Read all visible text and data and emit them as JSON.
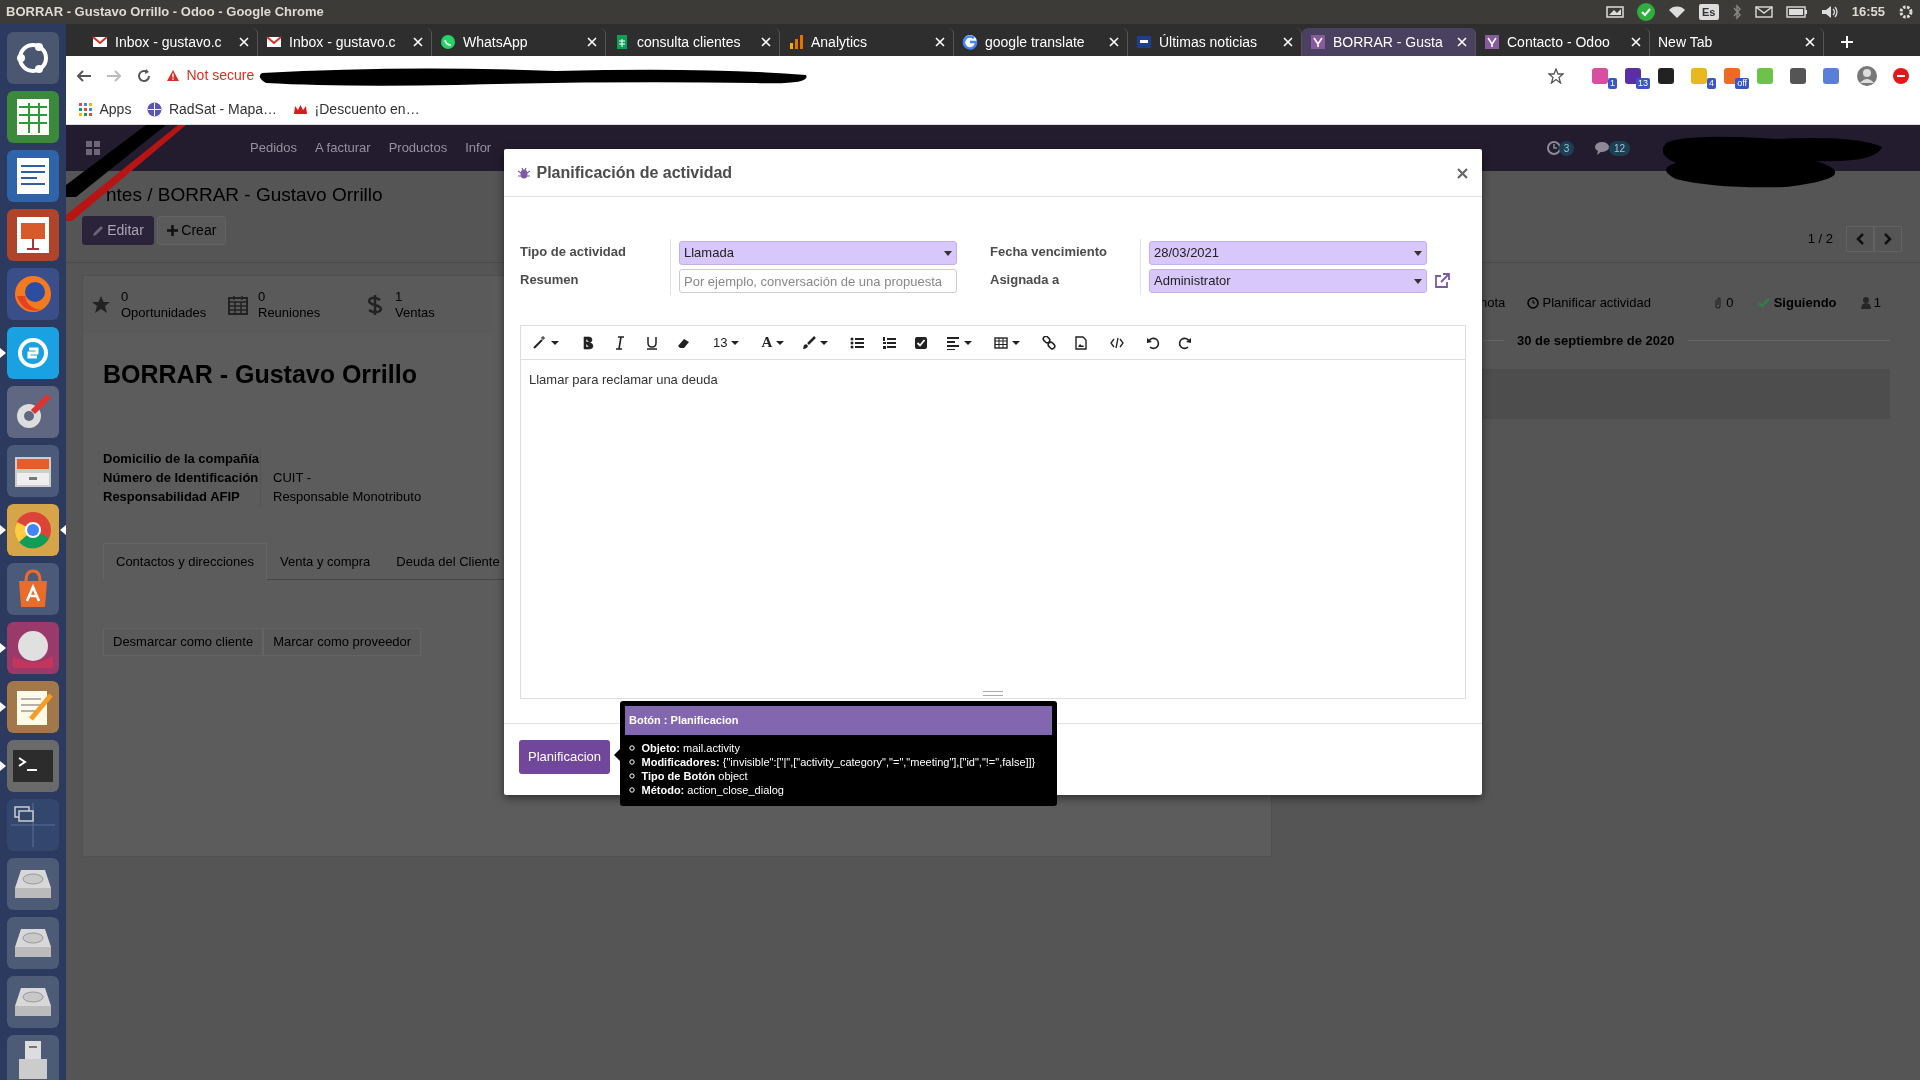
{
  "top_bar": {
    "title": "BORRAR - Gustavo Orrillo - Odoo - Google Chrome",
    "keyboard_layout": "Es",
    "time": "16:55"
  },
  "launcher": [
    {
      "kind": "ubuntu",
      "running": false,
      "focused": false
    },
    {
      "kind": "calc",
      "running": false,
      "focused": false
    },
    {
      "kind": "writer",
      "running": false,
      "focused": false
    },
    {
      "kind": "impress",
      "running": false,
      "focused": false
    },
    {
      "kind": "firefox",
      "running": false,
      "focused": false
    },
    {
      "kind": "skype",
      "running": true,
      "focused": false
    },
    {
      "kind": "settings",
      "running": false,
      "focused": false
    },
    {
      "kind": "cabinet",
      "running": false,
      "focused": false
    },
    {
      "kind": "chrome",
      "running": true,
      "focused": true
    },
    {
      "kind": "store",
      "running": false,
      "focused": false
    },
    {
      "kind": "ball",
      "running": true,
      "focused": false
    },
    {
      "kind": "editor",
      "running": true,
      "focused": false
    },
    {
      "kind": "terminal",
      "running": true,
      "focused": false
    },
    {
      "kind": "workspaces",
      "running": false,
      "focused": false
    },
    {
      "kind": "drive",
      "running": false,
      "focused": false
    },
    {
      "kind": "drive",
      "running": false,
      "focused": false
    },
    {
      "kind": "drive",
      "running": false,
      "focused": false
    },
    {
      "kind": "usb",
      "running": false,
      "focused": false
    }
  ],
  "tabs": [
    {
      "title": "Inbox - gustavo.c",
      "kind": "mail",
      "selected": false
    },
    {
      "title": "Inbox - gustavo.c",
      "kind": "mail",
      "selected": false
    },
    {
      "title": "WhatsApp",
      "kind": "chat",
      "selected": false
    },
    {
      "title": "consulta clientes",
      "kind": "sheet",
      "selected": false
    },
    {
      "title": "Analytics",
      "kind": "analytics",
      "selected": false
    },
    {
      "title": "google translate",
      "kind": "google",
      "selected": false
    },
    {
      "title": "Últimas noticias",
      "kind": "news",
      "selected": false
    },
    {
      "title": "BORRAR - Gusta",
      "kind": "odoo",
      "selected": true
    },
    {
      "title": "Contacto - Odoo",
      "kind": "odoo",
      "selected": false
    },
    {
      "title": "New Tab",
      "kind": "blank",
      "selected": false
    }
  ],
  "address_bar": {
    "security": "Not secure"
  },
  "extensions": [
    {
      "color": "#d94fa0",
      "badge": "1"
    },
    {
      "color": "#5a2ea6",
      "badge": "13"
    },
    {
      "color": "#222222"
    },
    {
      "color": "#e8b81e",
      "badge": "4"
    },
    {
      "color": "#f06a21",
      "badge": "off"
    },
    {
      "color": "#6cc24a"
    },
    {
      "color": "#555555"
    },
    {
      "color": "#5b7fd6"
    }
  ],
  "bookmarks": [
    {
      "label": "Apps",
      "kind": "apps"
    },
    {
      "label": "RadSat - Mapa…",
      "kind": "globe"
    },
    {
      "label": "¡Descuento en…",
      "kind": "crown"
    }
  ],
  "odoo": {
    "menu": [
      "Pedidos",
      "A facturar",
      "Productos",
      "Infor"
    ],
    "systray": [
      {
        "kind": "activity",
        "count": "3"
      },
      {
        "kind": "messages",
        "count": "12"
      }
    ],
    "breadcrumb": "ntes / BORRAR - Gustavo Orrillo",
    "actions": [
      {
        "label": "Editar",
        "kind": "primary"
      },
      {
        "label": "Crear",
        "kind": "secondary"
      }
    ],
    "pager": "1 / 2",
    "stat_buttons": [
      {
        "kind": "star",
        "value": "0",
        "label": "Oportunidades"
      },
      {
        "kind": "calendar",
        "value": "0",
        "label": "Reuniones"
      },
      {
        "kind": "dollar",
        "value": "1",
        "label": "Ventas"
      }
    ],
    "record_name": "BORRAR - Gustavo Orrillo",
    "fields": [
      {
        "label": "Domicilio de la compañía"
      },
      {
        "label": "Número de Identificación",
        "value": "CUIT -"
      },
      {
        "label": "Responsabilidad AFIP",
        "value": "Responsable Monotributo"
      }
    ],
    "notebook_tabs": [
      {
        "label": "Contactos y direcciones",
        "selected": true
      },
      {
        "label": "Venta y compra",
        "selected": false
      },
      {
        "label": "Deuda del Cliente",
        "selected": false
      }
    ],
    "partner_buttons": [
      "Desmarcar como cliente",
      "Marcar como proveedor"
    ],
    "chatter": {
      "note": "nota",
      "schedule": "Planificar actividad",
      "attachments": "0",
      "follow": "Siguiendo",
      "followers": "1",
      "date": "30 de septiembre de 2020"
    }
  },
  "dialog": {
    "title": "Planificación de actividad",
    "field_groups": [
      [
        {
          "label": "Tipo de actividad",
          "kind": "select",
          "value": "Llamada"
        },
        {
          "label": "Resumen",
          "kind": "text",
          "placeholder": "Por ejemplo, conversación de una propuesta"
        }
      ],
      [
        {
          "label": "Fecha vencimiento",
          "kind": "select",
          "value": "28/03/2021"
        },
        {
          "label": "Asignada a",
          "kind": "select",
          "value": "Administrator",
          "external_link": true
        }
      ]
    ],
    "toolbar": [
      [
        {
          "kind": "magic",
          "dropdown": true
        }
      ],
      [
        {
          "kind": "bold"
        },
        {
          "kind": "italic"
        },
        {
          "kind": "underline"
        },
        {
          "kind": "eraser"
        }
      ],
      [
        {
          "kind": "font-size",
          "label": "13",
          "dropdown": true
        }
      ],
      [
        {
          "kind": "font-color",
          "label": "A",
          "dropdown": true
        },
        {
          "kind": "brush",
          "dropdown": true
        }
      ],
      [
        {
          "kind": "ul"
        },
        {
          "kind": "ol"
        },
        {
          "kind": "checklist"
        },
        {
          "kind": "align",
          "dropdown": true
        }
      ],
      [
        {
          "kind": "table",
          "dropdown": true
        }
      ],
      [
        {
          "kind": "link"
        },
        {
          "kind": "image"
        }
      ],
      [
        {
          "kind": "code"
        }
      ],
      [
        {
          "kind": "undo"
        },
        {
          "kind": "redo"
        }
      ]
    ],
    "body": "Llamar para reclamar una deuda",
    "button": "Planificacion",
    "tooltip": {
      "title": "Botón : Planificacion",
      "items": [
        {
          "label": "Objeto:",
          "value": "mail.activity"
        },
        {
          "label": "Modificadores:",
          "value": "{\"invisible\":[\"|\",[\"activity_category\",\"=\",\"meeting\"],[\"id\",\"!=\",false]]}"
        },
        {
          "label": "Tipo de Botón",
          "value": "object"
        },
        {
          "label": "Método:",
          "value": "action_close_dialog"
        }
      ]
    }
  }
}
